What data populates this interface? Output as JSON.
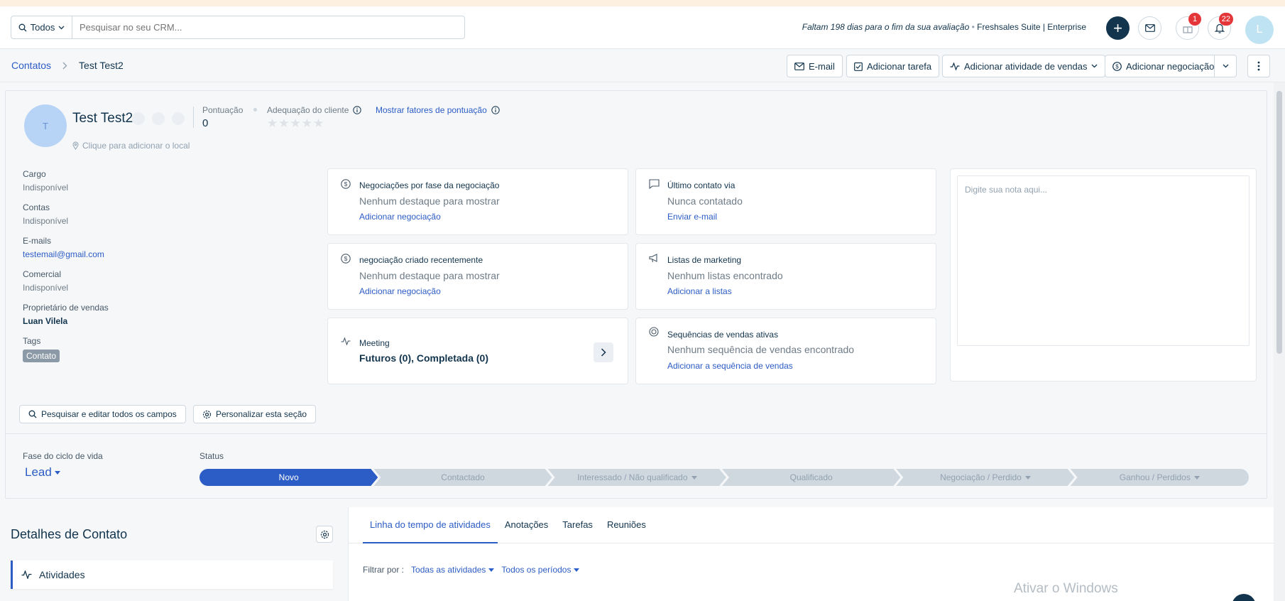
{
  "topbar": {
    "scope_label": "Todos",
    "search_placeholder": "Pesquisar no seu CRM...",
    "trial_text": "Faltam 198 dias para o fim da sua avaliação",
    "product_text": "Freshsales Suite | Enterprise",
    "gift_badge": "1",
    "notif_badge": "22",
    "avatar_initial": "L"
  },
  "breadcrumb": {
    "parent": "Contatos",
    "current": "Test Test2"
  },
  "actions": {
    "email": "E-mail",
    "add_task": "Adicionar tarefa",
    "add_sales_activity": "Adicionar atividade de vendas",
    "add_deal": "Adicionar negociação"
  },
  "profile": {
    "avatar_initial": "T",
    "name": "Test Test2",
    "score_label": "Pontuação",
    "score_value": "0",
    "fit_label": "Adequação do cliente",
    "fit_stars": "★★★★★",
    "show_factors": "Mostrar fatores de pontuação",
    "location_placeholder": "Clique para adicionar o local"
  },
  "fields": [
    {
      "label": "Cargo",
      "value": "Indisponível",
      "style": "muted"
    },
    {
      "label": "Contas",
      "value": "Indisponível",
      "style": "muted"
    },
    {
      "label": "E-mails",
      "value": "testemail@gmail.com",
      "style": "link"
    },
    {
      "label": "Comercial",
      "value": "Indisponível",
      "style": "muted"
    },
    {
      "label": "Proprietário de vendas",
      "value": "Luan Vilela",
      "style": "bold"
    }
  ],
  "tags": {
    "label": "Tags",
    "value": "Contato"
  },
  "widgets": {
    "deals_by_stage": {
      "title": "Negociações por fase da negociação",
      "body": "Nenhum destaque para mostrar",
      "link": "Adicionar negociação"
    },
    "last_contact": {
      "title": "Último contato via",
      "body": "Nunca contatado",
      "link": "Enviar e-mail"
    },
    "recent_deal": {
      "title": "negociação criado recentemente",
      "body": "Nenhum destaque para mostrar",
      "link": "Adicionar negociação"
    },
    "marketing_lists": {
      "title": "Listas de marketing",
      "body": "Nenhum listas encontrado",
      "link": "Adicionar a listas"
    },
    "meeting": {
      "title": "Meeting",
      "body": "Futuros (0), Completada (0)"
    },
    "sequences": {
      "title": "Sequências de vendas ativas",
      "body": "Nenhum sequência de vendas encontrado",
      "link": "Adicionar a sequência de vendas"
    }
  },
  "note": {
    "placeholder": "Digite sua nota aqui..."
  },
  "buttons": {
    "search_fields": "Pesquisar e editar todos os campos",
    "customize": "Personalizar esta seção"
  },
  "lifecycle": {
    "label": "Fase do ciclo de vida",
    "value": "Lead",
    "status_label": "Status",
    "stages": [
      "Novo",
      "Contactado",
      "Interessado / Não qualificado",
      "Qualificado",
      "Negociação / Perdido",
      "Ganhou / Perdidos"
    ]
  },
  "left_panel": {
    "title": "Detalhes de Contato",
    "item": "Atividades"
  },
  "right_panel": {
    "tabs": [
      "Linha do tempo de atividades",
      "Anotações",
      "Tarefas",
      "Reuniões"
    ],
    "filter_label": "Filtrar por :",
    "filter_activities": "Todas as atividades",
    "filter_periods": "Todos os períodos"
  },
  "watermark": "Ativar o Windows",
  "colors": {
    "accent": "#2c5cc5",
    "navy": "#12344d",
    "badge": "#e43538"
  }
}
